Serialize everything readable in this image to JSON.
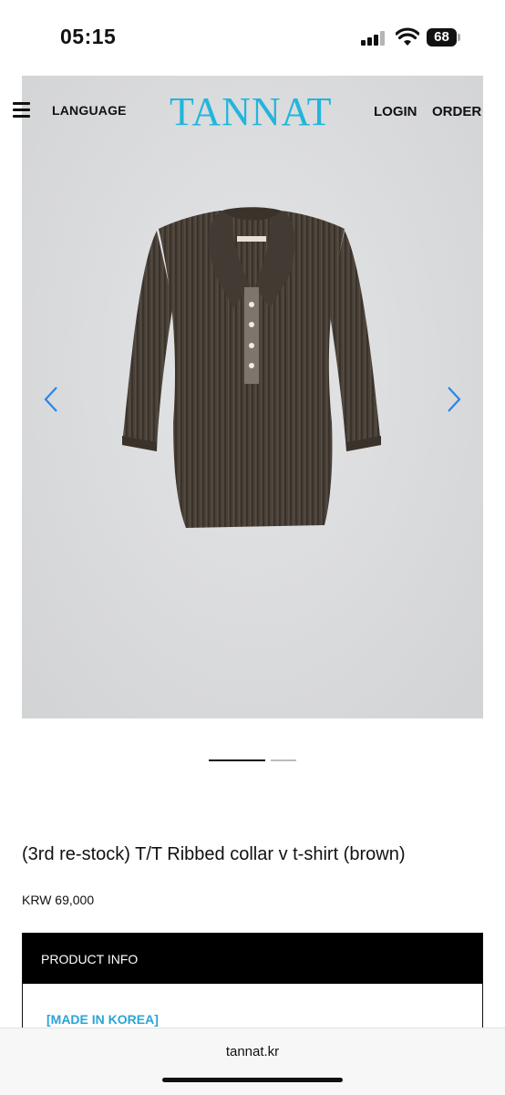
{
  "status_bar": {
    "time": "05:15",
    "battery": "68"
  },
  "header": {
    "menu_icon": "hamburger-menu-icon",
    "language_label": "LANGUAGE",
    "logo_text": "TANNAT",
    "login_label": "LOGIN",
    "order_label": "ORDER",
    "logo_color": "#22b5dc"
  },
  "gallery": {
    "prev_icon": "chevron-left-icon",
    "next_icon": "chevron-right-icon",
    "pages": 2,
    "current_page": 1,
    "image": "brown ribbed collar t-shirt photo"
  },
  "product": {
    "title": "(3rd re-stock) T/T Ribbed collar v t-shirt (brown)",
    "price": "KRW 69,000"
  },
  "info": {
    "header": "PRODUCT INFO",
    "made_in": "[MADE IN KOREA]",
    "accent_color": "#2aa4d8"
  },
  "browser": {
    "url": "tannat.kr"
  }
}
